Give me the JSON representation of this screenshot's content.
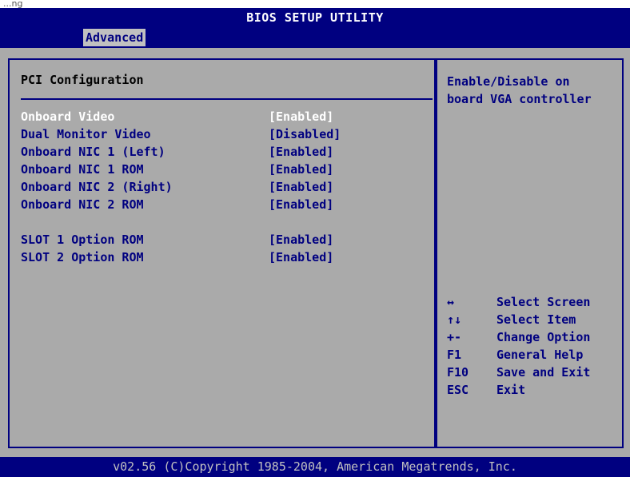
{
  "header": {
    "caption": "...ng",
    "title": "BIOS SETUP UTILITY"
  },
  "menu": {
    "tabs": [
      {
        "label": "Advanced",
        "selected": true
      }
    ]
  },
  "main": {
    "section_title": "PCI Configuration",
    "items": [
      {
        "label": "Onboard Video",
        "value": "[Enabled]",
        "selected": true
      },
      {
        "label": "Dual Monitor Video",
        "value": "[Disabled]"
      },
      {
        "label": "Onboard NIC 1 (Left)",
        "value": "[Enabled]"
      },
      {
        "label": "Onboard NIC 1 ROM",
        "value": "[Enabled]"
      },
      {
        "label": "Onboard NIC 2 (Right)",
        "value": "[Enabled]"
      },
      {
        "label": "Onboard NIC 2 ROM",
        "value": "[Enabled]"
      },
      {
        "label": "SLOT 1 Option ROM",
        "value": "[Enabled]"
      },
      {
        "label": "SLOT 2 Option ROM",
        "value": "[Enabled]"
      }
    ]
  },
  "help": {
    "line1": "Enable/Disable on",
    "line2": "board VGA controller",
    "keys": [
      {
        "key": "↔",
        "desc": "Select Screen"
      },
      {
        "key": "↑↓",
        "desc": "Select Item"
      },
      {
        "key": "+-",
        "desc": "Change Option"
      },
      {
        "key": "F1",
        "desc": "General Help"
      },
      {
        "key": "F10",
        "desc": "Save and Exit"
      },
      {
        "key": "ESC",
        "desc": "Exit"
      }
    ]
  },
  "footer": {
    "text": "v02.56 (C)Copyright 1985-2004, American Megatrends, Inc."
  },
  "colors": {
    "bios_blue": "#000080",
    "panel_gray": "#aaaaaa",
    "tab_gray": "#c0c0c0",
    "highlight_white": "#ffffff"
  }
}
